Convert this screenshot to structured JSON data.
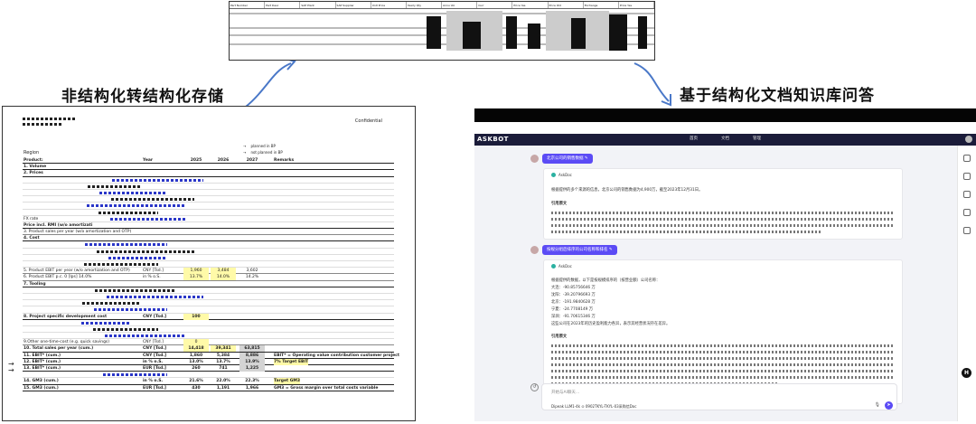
{
  "captions": {
    "left": "非结构化转结构化存储",
    "right": "基于结构化文档知识库问答"
  },
  "sheet": {
    "headers": [
      "Part Number",
      "Part Desc",
      "SAP Plant",
      "SAP Supplier",
      "Unit Price",
      "Yearly Qty",
      "Annu Vol",
      "Curr",
      "Price Yes",
      "Price Old",
      "Exchange",
      "Price Yes"
    ]
  },
  "document": {
    "confidential": "Confidential",
    "region": "Region",
    "planned": "planned in BP",
    "not_planned": "not planned in BP",
    "rows": [
      {
        "lbl": "Product:",
        "unit": "Year",
        "v1": "2025",
        "v2": "2026",
        "v3": "2027",
        "rem": "Remarks",
        "cls": "bold"
      },
      {
        "lbl": "1. Volume",
        "unit": "",
        "v1": "",
        "v2": "",
        "v3": "",
        "rem": "",
        "cls": "bold"
      },
      {
        "lbl": "2. Prices",
        "unit": "",
        "v1": "",
        "v2": "",
        "v3": "",
        "rem": "",
        "cls": "bold"
      },
      {
        "lbl": "",
        "unit": "",
        "v1": "",
        "v2": "",
        "v3": "",
        "rem": "",
        "cls": "thin"
      },
      {
        "lbl": "",
        "unit": "",
        "v1": "",
        "v2": "",
        "v3": "",
        "rem": "",
        "cls": "thin"
      },
      {
        "lbl": "",
        "unit": "",
        "v1": "",
        "v2": "",
        "v3": "",
        "rem": "",
        "cls": "thin"
      },
      {
        "lbl": "",
        "unit": "",
        "v1": "",
        "v2": "",
        "v3": "",
        "rem": "",
        "cls": "thin"
      },
      {
        "lbl": "",
        "unit": "",
        "v1": "",
        "v2": "",
        "v3": "",
        "rem": "",
        "cls": "thin"
      },
      {
        "lbl": "",
        "unit": "",
        "v1": "",
        "v2": "",
        "v3": "",
        "rem": "",
        "cls": "thin"
      },
      {
        "lbl": "           FX rate",
        "unit": "",
        "v1": "",
        "v2": "",
        "v3": "",
        "rem": "",
        "cls": "thin"
      },
      {
        "lbl": "           Price incl. RMI (w/o amortizati",
        "unit": "",
        "v1": "",
        "v2": "",
        "v3": "",
        "rem": "",
        "cls": "bold"
      },
      {
        "lbl": "3. Product sales per year (w/o amortization and OTP)",
        "unit": "",
        "v1": "",
        "v2": "",
        "v3": "",
        "rem": "",
        "cls": ""
      },
      {
        "lbl": "4. Cost",
        "unit": "",
        "v1": "",
        "v2": "",
        "v3": "",
        "rem": "",
        "cls": "bold"
      },
      {
        "lbl": "",
        "unit": "",
        "v1": "",
        "v2": "",
        "v3": "",
        "rem": "",
        "cls": "thin"
      },
      {
        "lbl": "",
        "unit": "",
        "v1": "",
        "v2": "",
        "v3": "",
        "rem": "",
        "cls": "thin"
      },
      {
        "lbl": "",
        "unit": "",
        "v1": "",
        "v2": "",
        "v3": "",
        "rem": "",
        "cls": "thin"
      },
      {
        "lbl": "",
        "unit": "",
        "v1": "",
        "v2": "",
        "v3": "",
        "rem": "",
        "cls": "thin"
      },
      {
        "lbl": "5. Product EBIT per year (w/o amortization and OTP)",
        "unit": "CNY [Tsd.]",
        "v1": "1,960",
        "v2": "3,484",
        "v3": "3,602",
        "rem": "",
        "cls": ""
      },
      {
        "lbl": "6. Product EBIT p.c.      0 [Ips]      14.0%",
        "unit": "in % o.S.",
        "v1": "13.7%",
        "v2": "14.0%",
        "v3": "14.2%",
        "rem": "",
        "cls": ""
      },
      {
        "lbl": "7. Tooling",
        "unit": "",
        "v1": "",
        "v2": "",
        "v3": "",
        "rem": "",
        "cls": "bold"
      },
      {
        "lbl": "",
        "unit": "",
        "v1": "",
        "v2": "",
        "v3": "",
        "rem": "",
        "cls": "thin"
      },
      {
        "lbl": "",
        "unit": "",
        "v1": "",
        "v2": "",
        "v3": "",
        "rem": "",
        "cls": "thin"
      },
      {
        "lbl": "",
        "unit": "",
        "v1": "",
        "v2": "",
        "v3": "",
        "rem": "",
        "cls": "thin"
      },
      {
        "lbl": "",
        "unit": "",
        "v1": "",
        "v2": "",
        "v3": "",
        "rem": "",
        "cls": "thin"
      },
      {
        "lbl": "8. Project specific development cost",
        "unit": "CNY [Tsd.]",
        "v1": "100",
        "v2": "",
        "v3": "",
        "rem": "",
        "cls": "bold"
      },
      {
        "lbl": "",
        "unit": "",
        "v1": "",
        "v2": "",
        "v3": "",
        "rem": "",
        "cls": "thin"
      },
      {
        "lbl": "",
        "unit": "",
        "v1": "",
        "v2": "",
        "v3": "",
        "rem": "",
        "cls": "thin"
      },
      {
        "lbl": "",
        "unit": "",
        "v1": "",
        "v2": "",
        "v3": "",
        "rem": "",
        "cls": "thin"
      },
      {
        "lbl": "9.Other one-time-cost (e.g. quick savings)",
        "unit": "CNY [Tsd.]",
        "v1": "0",
        "v2": "",
        "v3": "",
        "rem": "",
        "cls": ""
      },
      {
        "lbl": "10. Total sales per year (cum.)",
        "unit": "CNY [Tsd.]",
        "v1": "14,418",
        "v2": "39,341",
        "v3": "63,815",
        "rem": "",
        "cls": "bold"
      },
      {
        "lbl": "11. EBIT* (cum.)",
        "unit": "CNY [Tsd.]",
        "v1": "1,860",
        "v2": "5,384",
        "v3": "8,886",
        "rem": "EBIT* = Operating value contribution customer project",
        "cls": "bold"
      },
      {
        "lbl": "12. EBIT* (cum.)",
        "unit": "in % o.S.",
        "v1": "13.0%",
        "v2": "13.7%",
        "v3": "13.9%",
        "rem": "7% Target EBIT",
        "cls": "bold"
      },
      {
        "lbl": "13. EBIT* (cum.)",
        "unit": "EUR [Tsd.]",
        "v1": "260",
        "v2": "741",
        "v3": "1,225",
        "rem": "",
        "cls": "bold"
      },
      {
        "lbl": "",
        "unit": "",
        "v1": "",
        "v2": "",
        "v3": "",
        "rem": "",
        "cls": "thin"
      },
      {
        "lbl": "14. GM3 (cum.)",
        "unit": "in % o.S.",
        "v1": "21.6%",
        "v2": "22.0%",
        "v3": "22.3%",
        "rem": "Target GM3",
        "cls": "bold"
      },
      {
        "lbl": "15. GM3 (cum.)",
        "unit": "EUR [Tsd.]",
        "v1": "430",
        "v2": "1,191",
        "v3": "1,966",
        "rem": "GM3 = Gross margin over total costs variable",
        "cls": "bold"
      }
    ]
  },
  "chat": {
    "logo": "ASKBOT",
    "nav": [
      "首页",
      "文档",
      "管理"
    ],
    "q1": "北京公司的销售数据",
    "a1_tag": "AskDoc",
    "a1_line": "根据提供的多个来源的信息，北京公司的销售数据为4,900万，截至2023年12月31日。",
    "a1_ref": "引用原文",
    "q2": "按规分组后排序的公司名称和排名",
    "a2_tag": "AskDoc",
    "a2_lines": [
      "根据提供的数据，以下是按规模排序的（按营业额）公司名称：",
      "大连：-90.85756646 万",
      "沈阳：-39.20796693 万",
      "北京：-191.9840628 万",
      "宁夏：-24.7708149 万",
      "深圳：-91.70615346 万",
      "这些公司在2023年的历史盈利能力各异，表示其经营状况存在差异。"
    ],
    "a2_ref": "引用原文",
    "input_placeholder": "开始与AI聊天...",
    "model_line": "Dipeak LLM1-4k  ⊙  0902TKYL-TKYL-03采购信Doc",
    "send": "➤",
    "mic": "🎙",
    "new_chat": "↺",
    "float": "H"
  }
}
